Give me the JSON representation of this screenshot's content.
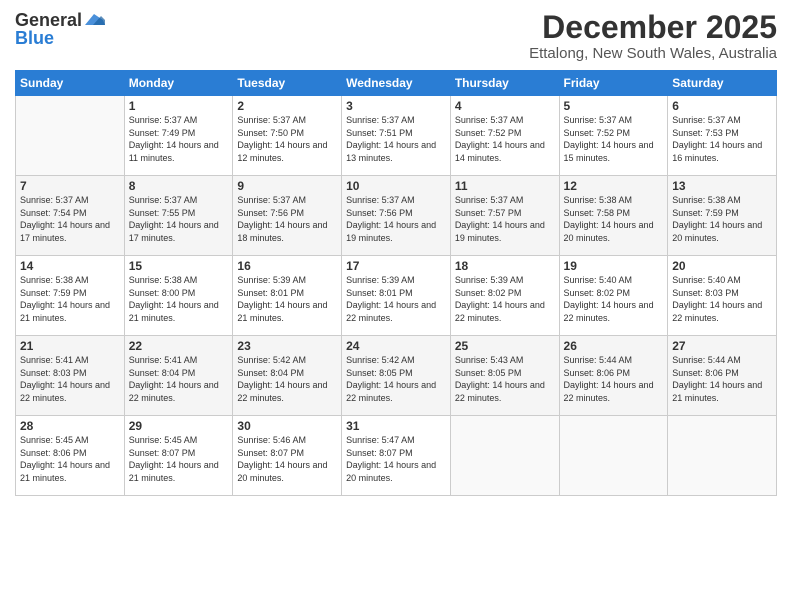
{
  "header": {
    "logo_general": "General",
    "logo_blue": "Blue",
    "month_title": "December 2025",
    "location": "Ettalong, New South Wales, Australia"
  },
  "days_of_week": [
    "Sunday",
    "Monday",
    "Tuesday",
    "Wednesday",
    "Thursday",
    "Friday",
    "Saturday"
  ],
  "weeks": [
    [
      {
        "day": "",
        "sunrise": "",
        "sunset": "",
        "daylight": ""
      },
      {
        "day": "1",
        "sunrise": "Sunrise: 5:37 AM",
        "sunset": "Sunset: 7:49 PM",
        "daylight": "Daylight: 14 hours and 11 minutes."
      },
      {
        "day": "2",
        "sunrise": "Sunrise: 5:37 AM",
        "sunset": "Sunset: 7:50 PM",
        "daylight": "Daylight: 14 hours and 12 minutes."
      },
      {
        "day": "3",
        "sunrise": "Sunrise: 5:37 AM",
        "sunset": "Sunset: 7:51 PM",
        "daylight": "Daylight: 14 hours and 13 minutes."
      },
      {
        "day": "4",
        "sunrise": "Sunrise: 5:37 AM",
        "sunset": "Sunset: 7:52 PM",
        "daylight": "Daylight: 14 hours and 14 minutes."
      },
      {
        "day": "5",
        "sunrise": "Sunrise: 5:37 AM",
        "sunset": "Sunset: 7:52 PM",
        "daylight": "Daylight: 14 hours and 15 minutes."
      },
      {
        "day": "6",
        "sunrise": "Sunrise: 5:37 AM",
        "sunset": "Sunset: 7:53 PM",
        "daylight": "Daylight: 14 hours and 16 minutes."
      }
    ],
    [
      {
        "day": "7",
        "sunrise": "Sunrise: 5:37 AM",
        "sunset": "Sunset: 7:54 PM",
        "daylight": "Daylight: 14 hours and 17 minutes."
      },
      {
        "day": "8",
        "sunrise": "Sunrise: 5:37 AM",
        "sunset": "Sunset: 7:55 PM",
        "daylight": "Daylight: 14 hours and 17 minutes."
      },
      {
        "day": "9",
        "sunrise": "Sunrise: 5:37 AM",
        "sunset": "Sunset: 7:56 PM",
        "daylight": "Daylight: 14 hours and 18 minutes."
      },
      {
        "day": "10",
        "sunrise": "Sunrise: 5:37 AM",
        "sunset": "Sunset: 7:56 PM",
        "daylight": "Daylight: 14 hours and 19 minutes."
      },
      {
        "day": "11",
        "sunrise": "Sunrise: 5:37 AM",
        "sunset": "Sunset: 7:57 PM",
        "daylight": "Daylight: 14 hours and 19 minutes."
      },
      {
        "day": "12",
        "sunrise": "Sunrise: 5:38 AM",
        "sunset": "Sunset: 7:58 PM",
        "daylight": "Daylight: 14 hours and 20 minutes."
      },
      {
        "day": "13",
        "sunrise": "Sunrise: 5:38 AM",
        "sunset": "Sunset: 7:59 PM",
        "daylight": "Daylight: 14 hours and 20 minutes."
      }
    ],
    [
      {
        "day": "14",
        "sunrise": "Sunrise: 5:38 AM",
        "sunset": "Sunset: 7:59 PM",
        "daylight": "Daylight: 14 hours and 21 minutes."
      },
      {
        "day": "15",
        "sunrise": "Sunrise: 5:38 AM",
        "sunset": "Sunset: 8:00 PM",
        "daylight": "Daylight: 14 hours and 21 minutes."
      },
      {
        "day": "16",
        "sunrise": "Sunrise: 5:39 AM",
        "sunset": "Sunset: 8:01 PM",
        "daylight": "Daylight: 14 hours and 21 minutes."
      },
      {
        "day": "17",
        "sunrise": "Sunrise: 5:39 AM",
        "sunset": "Sunset: 8:01 PM",
        "daylight": "Daylight: 14 hours and 22 minutes."
      },
      {
        "day": "18",
        "sunrise": "Sunrise: 5:39 AM",
        "sunset": "Sunset: 8:02 PM",
        "daylight": "Daylight: 14 hours and 22 minutes."
      },
      {
        "day": "19",
        "sunrise": "Sunrise: 5:40 AM",
        "sunset": "Sunset: 8:02 PM",
        "daylight": "Daylight: 14 hours and 22 minutes."
      },
      {
        "day": "20",
        "sunrise": "Sunrise: 5:40 AM",
        "sunset": "Sunset: 8:03 PM",
        "daylight": "Daylight: 14 hours and 22 minutes."
      }
    ],
    [
      {
        "day": "21",
        "sunrise": "Sunrise: 5:41 AM",
        "sunset": "Sunset: 8:03 PM",
        "daylight": "Daylight: 14 hours and 22 minutes."
      },
      {
        "day": "22",
        "sunrise": "Sunrise: 5:41 AM",
        "sunset": "Sunset: 8:04 PM",
        "daylight": "Daylight: 14 hours and 22 minutes."
      },
      {
        "day": "23",
        "sunrise": "Sunrise: 5:42 AM",
        "sunset": "Sunset: 8:04 PM",
        "daylight": "Daylight: 14 hours and 22 minutes."
      },
      {
        "day": "24",
        "sunrise": "Sunrise: 5:42 AM",
        "sunset": "Sunset: 8:05 PM",
        "daylight": "Daylight: 14 hours and 22 minutes."
      },
      {
        "day": "25",
        "sunrise": "Sunrise: 5:43 AM",
        "sunset": "Sunset: 8:05 PM",
        "daylight": "Daylight: 14 hours and 22 minutes."
      },
      {
        "day": "26",
        "sunrise": "Sunrise: 5:44 AM",
        "sunset": "Sunset: 8:06 PM",
        "daylight": "Daylight: 14 hours and 22 minutes."
      },
      {
        "day": "27",
        "sunrise": "Sunrise: 5:44 AM",
        "sunset": "Sunset: 8:06 PM",
        "daylight": "Daylight: 14 hours and 21 minutes."
      }
    ],
    [
      {
        "day": "28",
        "sunrise": "Sunrise: 5:45 AM",
        "sunset": "Sunset: 8:06 PM",
        "daylight": "Daylight: 14 hours and 21 minutes."
      },
      {
        "day": "29",
        "sunrise": "Sunrise: 5:45 AM",
        "sunset": "Sunset: 8:07 PM",
        "daylight": "Daylight: 14 hours and 21 minutes."
      },
      {
        "day": "30",
        "sunrise": "Sunrise: 5:46 AM",
        "sunset": "Sunset: 8:07 PM",
        "daylight": "Daylight: 14 hours and 20 minutes."
      },
      {
        "day": "31",
        "sunrise": "Sunrise: 5:47 AM",
        "sunset": "Sunset: 8:07 PM",
        "daylight": "Daylight: 14 hours and 20 minutes."
      },
      {
        "day": "",
        "sunrise": "",
        "sunset": "",
        "daylight": ""
      },
      {
        "day": "",
        "sunrise": "",
        "sunset": "",
        "daylight": ""
      },
      {
        "day": "",
        "sunrise": "",
        "sunset": "",
        "daylight": ""
      }
    ]
  ]
}
